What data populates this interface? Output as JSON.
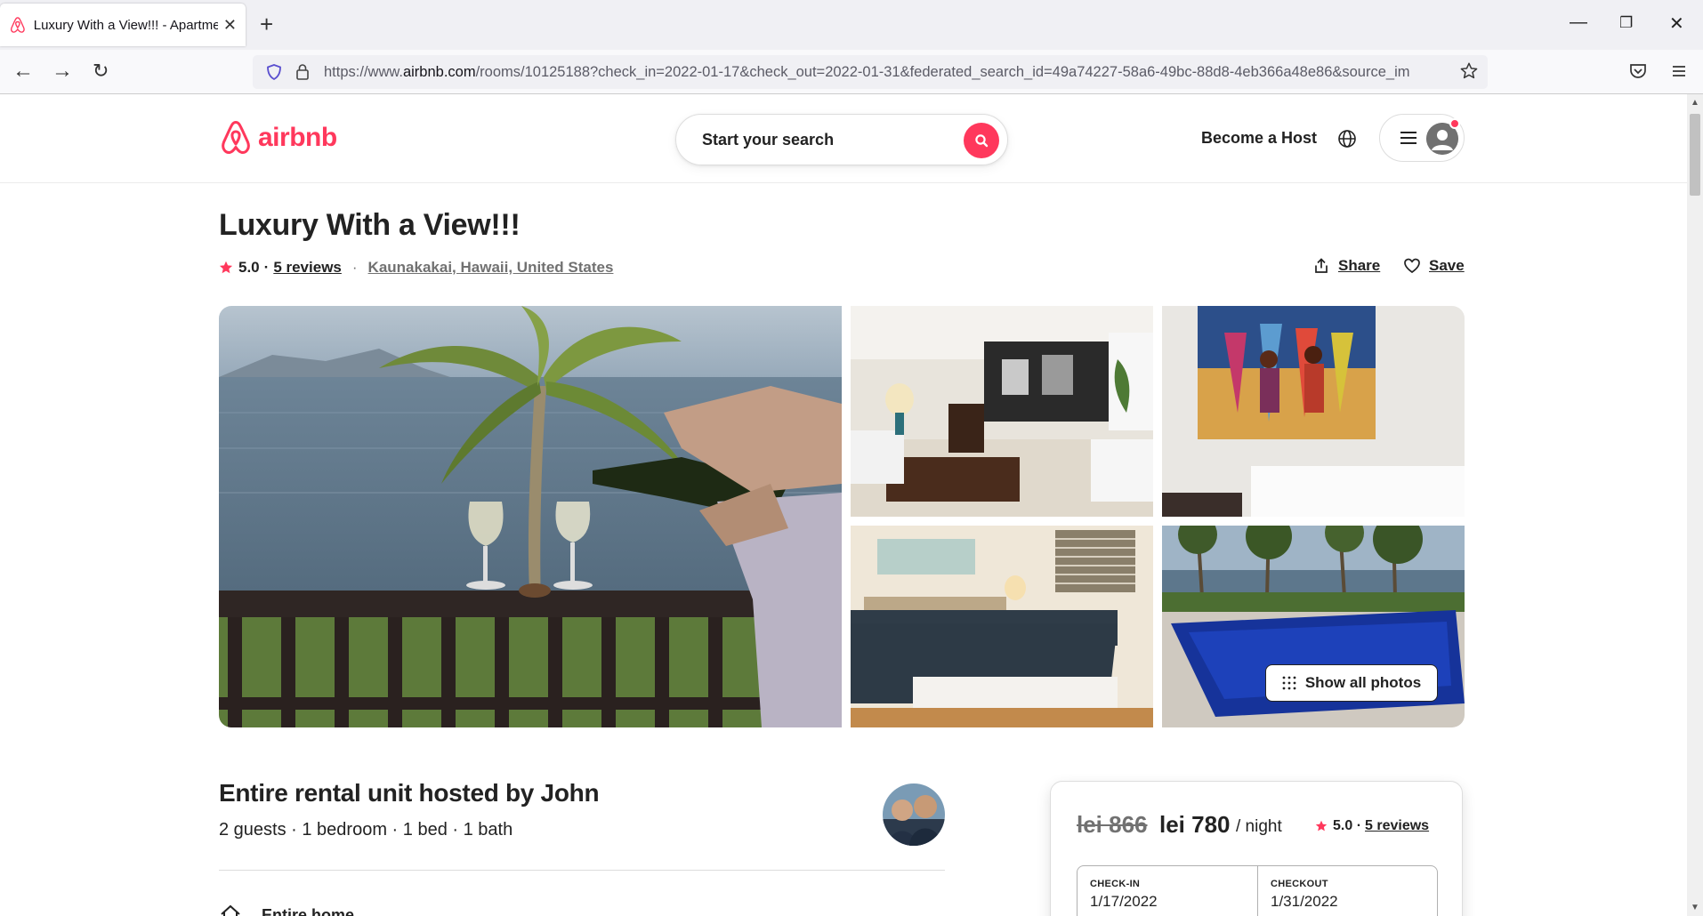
{
  "browser": {
    "tab_title": "Luxury With a View!!! - Apartme",
    "url_prefix": "https://www.",
    "url_domain": "airbnb.com",
    "url_rest": "/rooms/10125188?check_in=2022-01-17&check_out=2022-01-31&federated_search_id=49a74227-58a6-49bc-88d8-4eb366a48e86&source_im"
  },
  "header": {
    "logo_text": "airbnb",
    "search_label": "Start your search",
    "host_label": "Become a Host"
  },
  "listing": {
    "title": "Luxury With a View!!!",
    "rating": "5.0",
    "reviews_label": "5 reviews",
    "location": "Kaunakakai, Hawaii, United States",
    "share_label": "Share",
    "save_label": "Save",
    "show_all_label": "Show all photos",
    "hosted_by": "Entire rental unit hosted by John",
    "summary": "2 guests · 1 bedroom · 1 bed · 1 bath",
    "feature": "Entire home"
  },
  "booking": {
    "old_price": "lei 866",
    "price": "lei 780",
    "per": "/ night",
    "rating": "5.0 ·",
    "reviews_label": "5 reviews",
    "checkin_caption": "CHECK-IN",
    "checkin_value": "1/17/2022",
    "checkout_caption": "CHECKOUT",
    "checkout_value": "1/31/2022"
  },
  "colors": {
    "brand": "#ff385c",
    "text": "#222222",
    "muted": "#717171"
  }
}
